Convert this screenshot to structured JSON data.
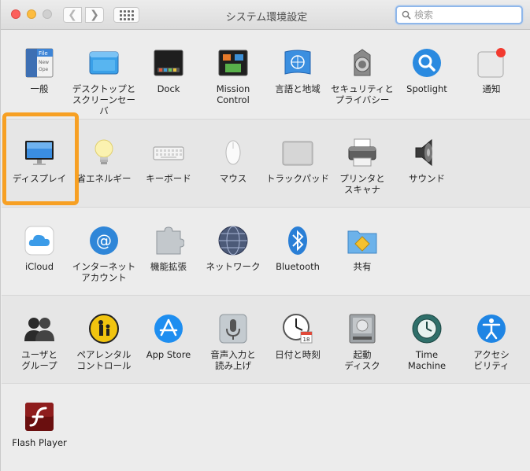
{
  "window": {
    "title": "システム環境設定"
  },
  "search": {
    "placeholder": "検索",
    "value": ""
  },
  "rows": [
    [
      {
        "id": "general",
        "label": "一般",
        "icon": "general-icon"
      },
      {
        "id": "desktop",
        "label": "デスクトップと\nスクリーンセーバ",
        "icon": "desktop-screensaver-icon"
      },
      {
        "id": "dock",
        "label": "Dock",
        "icon": "dock-icon"
      },
      {
        "id": "mission",
        "label": "Mission\nControl",
        "icon": "mission-control-icon"
      },
      {
        "id": "language",
        "label": "言語と地域",
        "icon": "language-region-icon"
      },
      {
        "id": "security",
        "label": "セキュリティと\nプライバシー",
        "icon": "security-icon"
      },
      {
        "id": "spotlight",
        "label": "Spotlight",
        "icon": "spotlight-icon"
      },
      {
        "id": "notifications",
        "label": "通知",
        "icon": "notifications-icon"
      }
    ],
    [
      {
        "id": "displays",
        "label": "ディスプレイ",
        "icon": "displays-icon"
      },
      {
        "id": "energy",
        "label": "省エネルギー",
        "icon": "energy-saver-icon"
      },
      {
        "id": "keyboard",
        "label": "キーボード",
        "icon": "keyboard-icon"
      },
      {
        "id": "mouse",
        "label": "マウス",
        "icon": "mouse-icon"
      },
      {
        "id": "trackpad",
        "label": "トラックパッド",
        "icon": "trackpad-icon"
      },
      {
        "id": "printers",
        "label": "プリンタと\nスキャナ",
        "icon": "printer-icon"
      },
      {
        "id": "sound",
        "label": "サウンド",
        "icon": "sound-icon"
      }
    ],
    [
      {
        "id": "icloud",
        "label": "iCloud",
        "icon": "icloud-icon"
      },
      {
        "id": "internet",
        "label": "インターネット\nアカウント",
        "icon": "internet-accounts-icon"
      },
      {
        "id": "extensions",
        "label": "機能拡張",
        "icon": "extensions-icon"
      },
      {
        "id": "network",
        "label": "ネットワーク",
        "icon": "network-icon"
      },
      {
        "id": "bluetooth",
        "label": "Bluetooth",
        "icon": "bluetooth-icon"
      },
      {
        "id": "sharing",
        "label": "共有",
        "icon": "sharing-icon"
      }
    ],
    [
      {
        "id": "users",
        "label": "ユーザと\nグループ",
        "icon": "users-groups-icon"
      },
      {
        "id": "parental",
        "label": "ペアレンタル\nコントロール",
        "icon": "parental-controls-icon"
      },
      {
        "id": "appstore",
        "label": "App Store",
        "icon": "app-store-icon"
      },
      {
        "id": "dictation",
        "label": "音声入力と\n読み上げ",
        "icon": "dictation-speech-icon"
      },
      {
        "id": "datetime",
        "label": "日付と時刻",
        "icon": "date-time-icon"
      },
      {
        "id": "startup",
        "label": "起動\nディスク",
        "icon": "startup-disk-icon"
      },
      {
        "id": "timemachine",
        "label": "Time\nMachine",
        "icon": "time-machine-icon"
      },
      {
        "id": "accessibility",
        "label": "アクセシ\nビリティ",
        "icon": "accessibility-icon"
      }
    ],
    [
      {
        "id": "flash",
        "label": "Flash Player",
        "icon": "flash-player-icon"
      }
    ]
  ],
  "highlighted_pane": "displays",
  "colors": {
    "highlight": "#f7a023",
    "search_focus": "#8fb7ea"
  }
}
